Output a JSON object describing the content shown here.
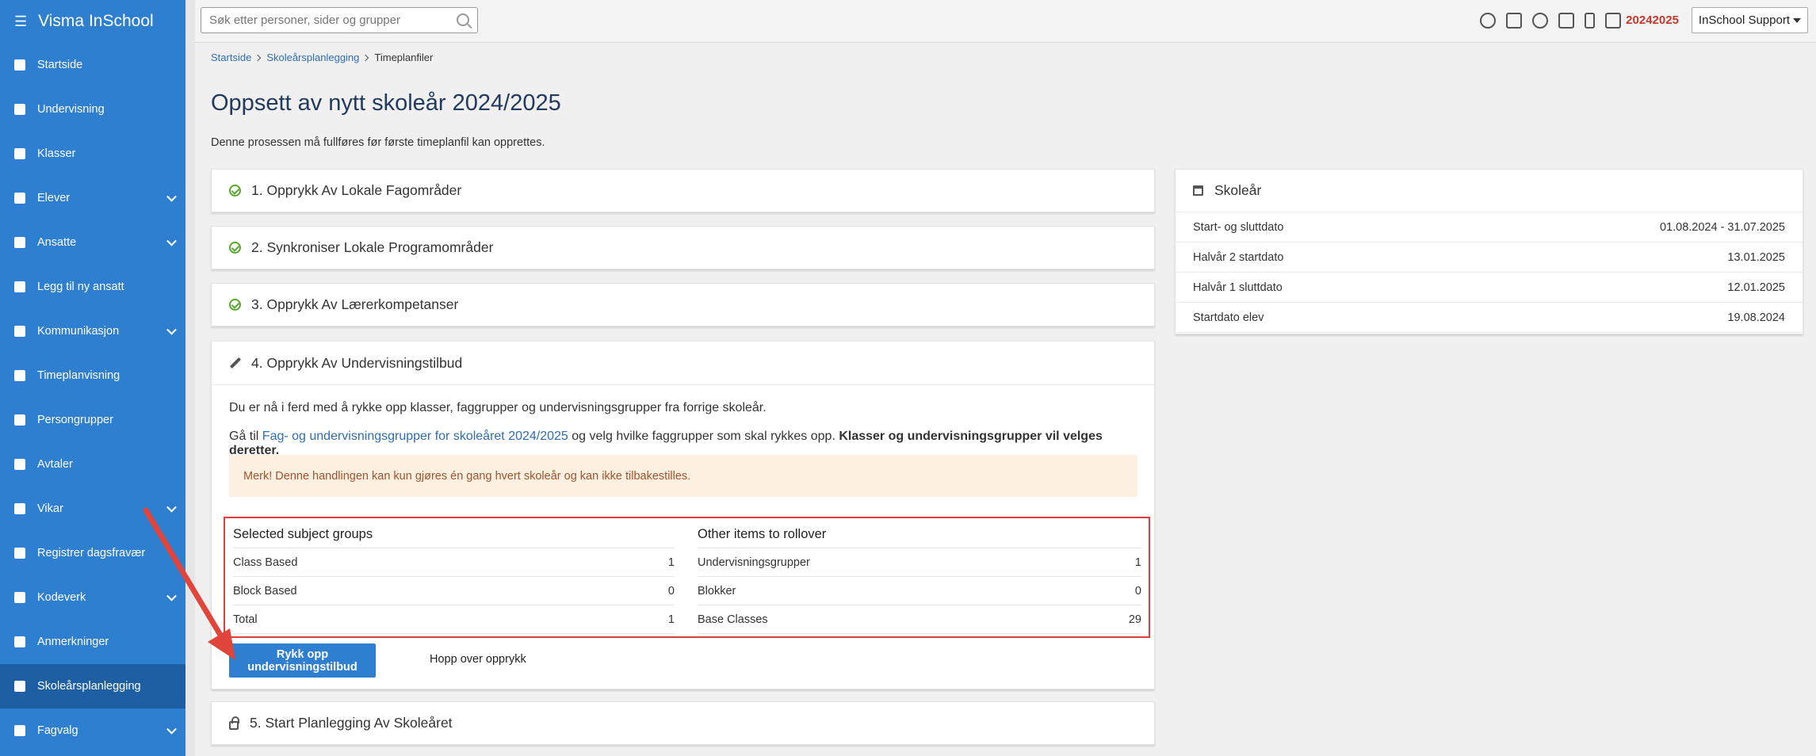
{
  "app": {
    "title": "Visma InSchool"
  },
  "sidebar": {
    "items": [
      {
        "label": "Startside",
        "icon": "grid-icon",
        "chevron": false
      },
      {
        "label": "Undervisning",
        "icon": "book-icon",
        "chevron": false
      },
      {
        "label": "Klasser",
        "icon": "board-icon",
        "chevron": false
      },
      {
        "label": "Elever",
        "icon": "students-icon",
        "chevron": true
      },
      {
        "label": "Ansatte",
        "icon": "briefcase-icon",
        "chevron": true
      },
      {
        "label": "Legg til ny ansatt",
        "icon": "plus-icon",
        "chevron": false
      },
      {
        "label": "Kommunikasjon",
        "icon": "chat-icon",
        "chevron": true
      },
      {
        "label": "Timeplanvisning",
        "icon": "calendar-icon",
        "chevron": false
      },
      {
        "label": "Persongrupper",
        "icon": "people-icon",
        "chevron": false
      },
      {
        "label": "Avtaler",
        "icon": "calendar-check-icon",
        "chevron": false
      },
      {
        "label": "Vikar",
        "icon": "refresh-icon",
        "chevron": true
      },
      {
        "label": "Registrer dagsfravær",
        "icon": "pencil-icon",
        "chevron": false
      },
      {
        "label": "Kodeverk",
        "icon": "database-icon",
        "chevron": true
      },
      {
        "label": "Anmerkninger",
        "icon": "hand-icon",
        "chevron": false
      },
      {
        "label": "Skoleårsplanlegging",
        "icon": "calendar-icon",
        "chevron": false,
        "active": true
      },
      {
        "label": "Fagvalg",
        "icon": "book-icon",
        "chevron": true
      }
    ]
  },
  "topbar": {
    "search_placeholder": "Søk etter personer, sider og grupper",
    "year_code": "20242025",
    "user_label": "InSchool Support"
  },
  "breadcrumb": [
    "Startside",
    "Skoleårsplanlegging",
    "Timeplanfiler"
  ],
  "page": {
    "title": "Oppsett av nytt skoleår 2024/2025",
    "lead": "Denne prosessen må fullføres før første timeplanfil kan opprettes."
  },
  "steps": [
    {
      "label": "1. Opprykk Av Lokale Fagområder",
      "status": "done"
    },
    {
      "label": "2. Synkroniser Lokale Programområder",
      "status": "done"
    },
    {
      "label": "3. Opprykk Av Lærerkompetanser",
      "status": "done"
    }
  ],
  "step4": {
    "title": "4. Opprykk Av Undervisningstilbud",
    "p1": "Du er nå i ferd med å rykke opp klasser, faggrupper og undervisningsgrupper fra forrige skoleår.",
    "p2_prefix": "Gå til ",
    "p2_link": "Fag- og undervisningsgrupper for skoleåret 2024/2025",
    "p2_mid": " og velg hvilke faggrupper som skal rykkes opp. ",
    "p2_bold": "Klasser og undervisningsgrupper vil velges deretter.",
    "alert": "Merk! Denne handlingen kan kun gjøres én gang hvert skoleår og kan ikke tilbakestilles.",
    "selected": {
      "title": "Selected subject groups",
      "rows": [
        {
          "label": "Class Based",
          "value": "1"
        },
        {
          "label": "Block Based",
          "value": "0"
        },
        {
          "label": "Total",
          "value": "1"
        }
      ]
    },
    "other": {
      "title": "Other items to rollover",
      "rows": [
        {
          "label": "Undervisningsgrupper",
          "value": "1"
        },
        {
          "label": "Blokker",
          "value": "0"
        },
        {
          "label": "Base Classes",
          "value": "29"
        }
      ]
    },
    "primary_button": "Rykk opp undervisningstilbud",
    "skip_button": "Hopp over opprykk"
  },
  "step5": {
    "title": "5. Start Planlegging Av Skoleåret"
  },
  "school_year": {
    "title": "Skoleår",
    "rows": [
      {
        "label": "Start- og sluttdato",
        "value": "01.08.2024 - 31.07.2025"
      },
      {
        "label": "Halvår 2 startdato",
        "value": "13.01.2025"
      },
      {
        "label": "Halvår 1 sluttdato",
        "value": "12.01.2025"
      },
      {
        "label": "Startdato elev",
        "value": "19.08.2024"
      }
    ]
  },
  "colors": {
    "sidebar": "#2e7fd0",
    "sidebar_active": "#1e5fa3",
    "accent": "#2e7fd0",
    "highlight": "#e23c3c",
    "success": "#5aa832"
  }
}
